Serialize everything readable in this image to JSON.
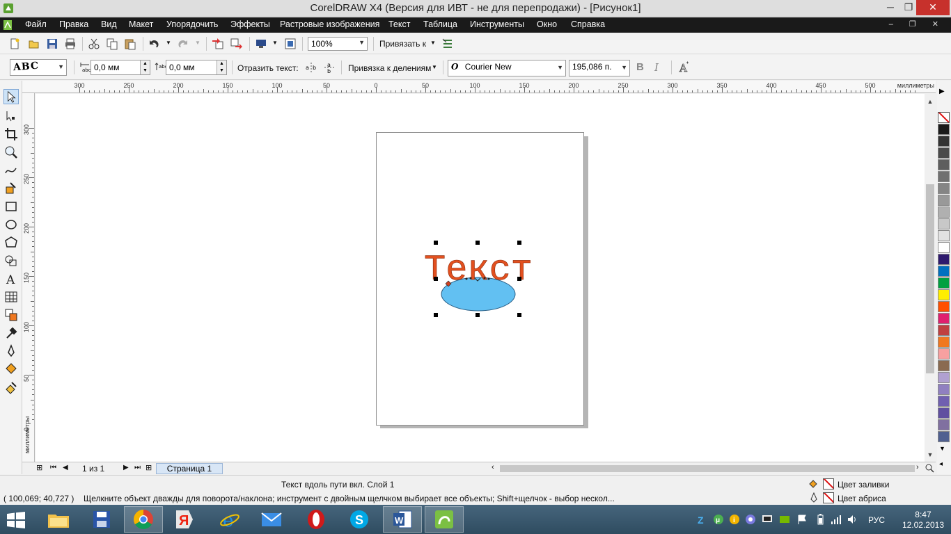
{
  "window": {
    "title": "CorelDRAW X4 (Версия для ИВТ - не для перепродажи) - [Рисунок1]",
    "controls": {
      "minimize": "─",
      "maximize": "❐",
      "close": "✕"
    }
  },
  "menu": {
    "items": [
      "Файл",
      "Правка",
      "Вид",
      "Макет",
      "Упорядочить",
      "Эффекты",
      "Растровые изображения",
      "Текст",
      "Таблица",
      "Инструменты",
      "Окно",
      "Справка"
    ],
    "doc_controls": "‒ ❐ ✕"
  },
  "standard_toolbar": {
    "zoom": "100%",
    "snap_label": "Привязать к"
  },
  "property_bar": {
    "text_preset": "ABC",
    "horizontal_offset": "0,0 мм",
    "vertical_offset": "0,0 мм",
    "mirror_label": "Отразить текст:",
    "snap_mode": "Привязка к делениям",
    "font_name": "Courier New",
    "font_size": "195,086 п."
  },
  "rulers": {
    "units": "миллиметры",
    "horizontal_ticks": [
      "300",
      "250",
      "200",
      "150",
      "100",
      "50",
      "0",
      "50",
      "100",
      "150",
      "200",
      "250",
      "300",
      "350",
      "400",
      "450",
      "500"
    ],
    "vertical_ticks": [
      "300",
      "250",
      "200",
      "150",
      "100",
      "50",
      "0"
    ]
  },
  "canvas": {
    "fit_text": "Текст",
    "text_color": "#e2501f",
    "ellipse_fill": "#62c0f2",
    "ellipse_stroke": "#2a5f86"
  },
  "page_nav": {
    "counter": "1 из 1",
    "tab": "Страница 1"
  },
  "status": {
    "object_info": "Текст вдоль пути вкл. Слой 1",
    "coordinates": "( 100,069; 40,727 )",
    "hint": "Щелкните объект дважды для поворота/наклона; инструмент с двойным щелчком выбирает все объекты; Shift+щелчок - выбор нескол...",
    "fill_label": "Цвет заливки",
    "outline_label": "Цвет абриса"
  },
  "palette_colors": [
    "#1a1a1a",
    "#333333",
    "#4a4a4a",
    "#5e5e5e",
    "#707070",
    "#858585",
    "#999999",
    "#b0b0b0",
    "#c8c8c8",
    "#e2e2e2",
    "#ffffff",
    "#2e1a6e",
    "#0070c0",
    "#00a040",
    "#ffee00",
    "#ff5000",
    "#e0206e",
    "#c04040",
    "#f07820",
    "#f7a0a0",
    "#8a6a50",
    "#b0a0d0",
    "#9080c0",
    "#7060b0",
    "#6050a0",
    "#8070a0",
    "#506090"
  ],
  "taskbar": {
    "language": "РУС",
    "time": "8:47",
    "date": "12.02.2013"
  }
}
